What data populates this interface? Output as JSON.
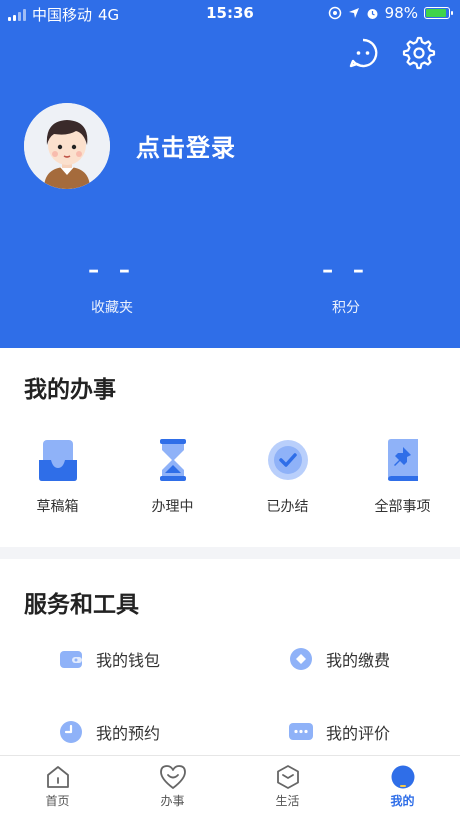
{
  "status_bar": {
    "carrier": "中国移动",
    "network": "4G",
    "time": "15:36",
    "battery": "98%"
  },
  "header": {
    "login_text": "点击登录",
    "stats": [
      {
        "value": "– –",
        "label": "收藏夹"
      },
      {
        "value": "– –",
        "label": "积分"
      }
    ],
    "colors": {
      "primary": "#2f6ee8"
    }
  },
  "my_affairs": {
    "title": "我的办事",
    "items": [
      {
        "label": "草稿箱",
        "icon": "inbox-icon"
      },
      {
        "label": "办理中",
        "icon": "hourglass-icon"
      },
      {
        "label": "已办结",
        "icon": "check-circle-icon"
      },
      {
        "label": "全部事项",
        "icon": "pin-icon"
      }
    ]
  },
  "services": {
    "title": "服务和工具",
    "items": [
      {
        "label": "我的钱包",
        "icon": "wallet-icon"
      },
      {
        "label": "我的缴费",
        "icon": "payment-icon"
      },
      {
        "label": "我的预约",
        "icon": "clock-icon"
      },
      {
        "label": "我的评价",
        "icon": "chat-icon"
      }
    ]
  },
  "tabbar": {
    "tabs": [
      {
        "label": "首页",
        "icon": "home-icon"
      },
      {
        "label": "办事",
        "icon": "heart-icon"
      },
      {
        "label": "生活",
        "icon": "box-icon"
      },
      {
        "label": "我的",
        "icon": "user-dot-icon",
        "active": true
      }
    ]
  }
}
